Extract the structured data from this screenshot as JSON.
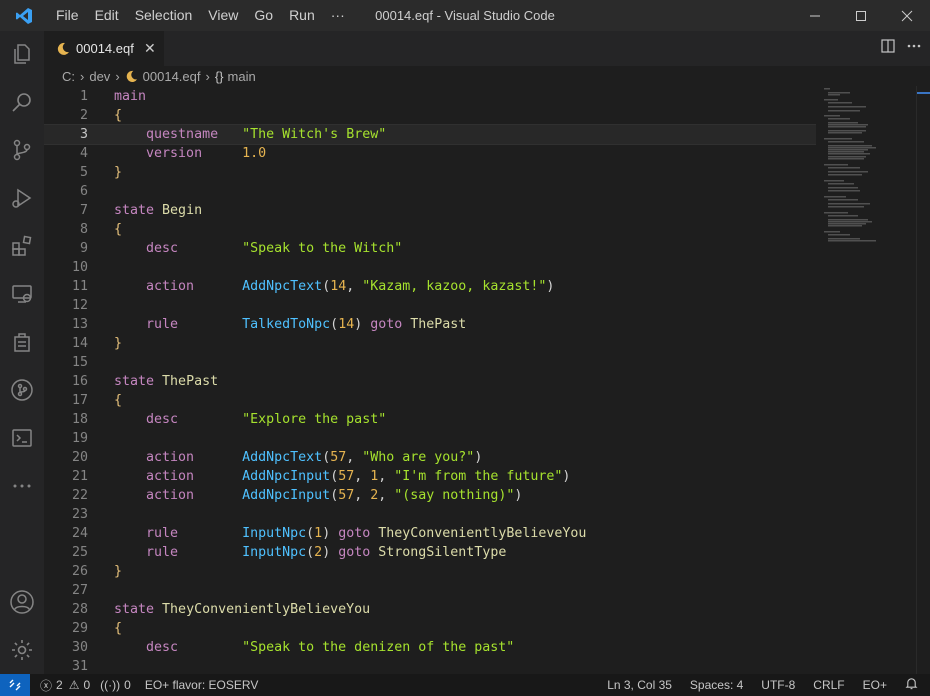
{
  "window": {
    "title": "00014.eqf - Visual Studio Code"
  },
  "menu": [
    "File",
    "Edit",
    "Selection",
    "View",
    "Go",
    "Run",
    "···"
  ],
  "tab": {
    "label": "00014.eqf",
    "close": "✕"
  },
  "breadcrumb": {
    "drive": "C:",
    "folder": "dev",
    "file": "00014.eqf",
    "symbol": "main"
  },
  "editor": {
    "current_line": 3,
    "lines": [
      [
        [
          "kw",
          "main"
        ]
      ],
      [
        [
          "br",
          "{"
        ]
      ],
      [
        [
          "ph",
          "    "
        ],
        [
          "kw",
          "questname"
        ],
        [
          "ph",
          "   "
        ],
        [
          "str",
          "\"The Witch's Brew\""
        ]
      ],
      [
        [
          "ph",
          "    "
        ],
        [
          "kw",
          "version"
        ],
        [
          "ph",
          "     "
        ],
        [
          "num",
          "1.0"
        ]
      ],
      [
        [
          "br",
          "}"
        ]
      ],
      [],
      [
        [
          "kw",
          "state"
        ],
        [
          "ph",
          " "
        ],
        [
          "nm",
          "Begin"
        ]
      ],
      [
        [
          "br",
          "{"
        ]
      ],
      [
        [
          "ph",
          "    "
        ],
        [
          "kw",
          "desc"
        ],
        [
          "ph",
          "        "
        ],
        [
          "str",
          "\"Speak to the Witch\""
        ]
      ],
      [],
      [
        [
          "ph",
          "    "
        ],
        [
          "kw",
          "action"
        ],
        [
          "ph",
          "      "
        ],
        [
          "fn",
          "AddNpcText"
        ],
        [
          "ph",
          "("
        ],
        [
          "num",
          "14"
        ],
        [
          "ph",
          ", "
        ],
        [
          "str",
          "\"Kazam, kazoo, kazast!\""
        ],
        [
          "ph",
          ")"
        ]
      ],
      [],
      [
        [
          "ph",
          "    "
        ],
        [
          "kw",
          "rule"
        ],
        [
          "ph",
          "        "
        ],
        [
          "fn",
          "TalkedToNpc"
        ],
        [
          "ph",
          "("
        ],
        [
          "num",
          "14"
        ],
        [
          "ph",
          ") "
        ],
        [
          "kw",
          "goto"
        ],
        [
          "ph",
          " "
        ],
        [
          "nm",
          "ThePast"
        ]
      ],
      [
        [
          "br",
          "}"
        ]
      ],
      [],
      [
        [
          "kw",
          "state"
        ],
        [
          "ph",
          " "
        ],
        [
          "nm",
          "ThePast"
        ]
      ],
      [
        [
          "br",
          "{"
        ]
      ],
      [
        [
          "ph",
          "    "
        ],
        [
          "kw",
          "desc"
        ],
        [
          "ph",
          "        "
        ],
        [
          "str",
          "\"Explore the past\""
        ]
      ],
      [],
      [
        [
          "ph",
          "    "
        ],
        [
          "kw",
          "action"
        ],
        [
          "ph",
          "      "
        ],
        [
          "fn",
          "AddNpcText"
        ],
        [
          "ph",
          "("
        ],
        [
          "num",
          "57"
        ],
        [
          "ph",
          ", "
        ],
        [
          "str",
          "\"Who are you?\""
        ],
        [
          "ph",
          ")"
        ]
      ],
      [
        [
          "ph",
          "    "
        ],
        [
          "kw",
          "action"
        ],
        [
          "ph",
          "      "
        ],
        [
          "fn",
          "AddNpcInput"
        ],
        [
          "ph",
          "("
        ],
        [
          "num",
          "57"
        ],
        [
          "ph",
          ", "
        ],
        [
          "num",
          "1"
        ],
        [
          "ph",
          ", "
        ],
        [
          "str",
          "\"I'm from the future\""
        ],
        [
          "ph",
          ")"
        ]
      ],
      [
        [
          "ph",
          "    "
        ],
        [
          "kw",
          "action"
        ],
        [
          "ph",
          "      "
        ],
        [
          "fn",
          "AddNpcInput"
        ],
        [
          "ph",
          "("
        ],
        [
          "num",
          "57"
        ],
        [
          "ph",
          ", "
        ],
        [
          "num",
          "2"
        ],
        [
          "ph",
          ", "
        ],
        [
          "str",
          "\"(say nothing)\""
        ],
        [
          "ph",
          ")"
        ]
      ],
      [],
      [
        [
          "ph",
          "    "
        ],
        [
          "kw",
          "rule"
        ],
        [
          "ph",
          "        "
        ],
        [
          "fn",
          "InputNpc"
        ],
        [
          "ph",
          "("
        ],
        [
          "num",
          "1"
        ],
        [
          "ph",
          ") "
        ],
        [
          "kw",
          "goto"
        ],
        [
          "ph",
          " "
        ],
        [
          "nm",
          "TheyConvenientlyBelieveYou"
        ]
      ],
      [
        [
          "ph",
          "    "
        ],
        [
          "kw",
          "rule"
        ],
        [
          "ph",
          "        "
        ],
        [
          "fn",
          "InputNpc"
        ],
        [
          "ph",
          "("
        ],
        [
          "num",
          "2"
        ],
        [
          "ph",
          ") "
        ],
        [
          "kw",
          "goto"
        ],
        [
          "ph",
          " "
        ],
        [
          "nm",
          "StrongSilentType"
        ]
      ],
      [
        [
          "br",
          "}"
        ]
      ],
      [],
      [
        [
          "kw",
          "state"
        ],
        [
          "ph",
          " "
        ],
        [
          "nm",
          "TheyConvenientlyBelieveYou"
        ]
      ],
      [
        [
          "br",
          "{"
        ]
      ],
      [
        [
          "ph",
          "    "
        ],
        [
          "kw",
          "desc"
        ],
        [
          "ph",
          "        "
        ],
        [
          "str",
          "\"Speak to the denizen of the past\""
        ]
      ],
      []
    ]
  },
  "statusbar": {
    "errors": "2",
    "warnings": "0",
    "ports": "0",
    "flavor": "EO+ flavor: EOSERV",
    "position": "Ln 3, Col 35",
    "spaces": "Spaces: 4",
    "encoding": "UTF-8",
    "eol": "CRLF",
    "language": "EO+"
  },
  "colors": {
    "accent": "#0e63be",
    "keyword": "#c586c0",
    "string": "#a6e22e",
    "function": "#4fc1ff",
    "number": "#e6b450",
    "state_name": "#dcdcaa"
  },
  "icons": {
    "activity": [
      "explorer-icon",
      "search-icon",
      "source-control-icon",
      "run-debug-icon",
      "extensions-icon",
      "remote-explorer-icon",
      "test-icon",
      "git-graph-icon",
      "terminal-icon",
      "more-icon",
      "account-icon",
      "settings-icon"
    ]
  }
}
